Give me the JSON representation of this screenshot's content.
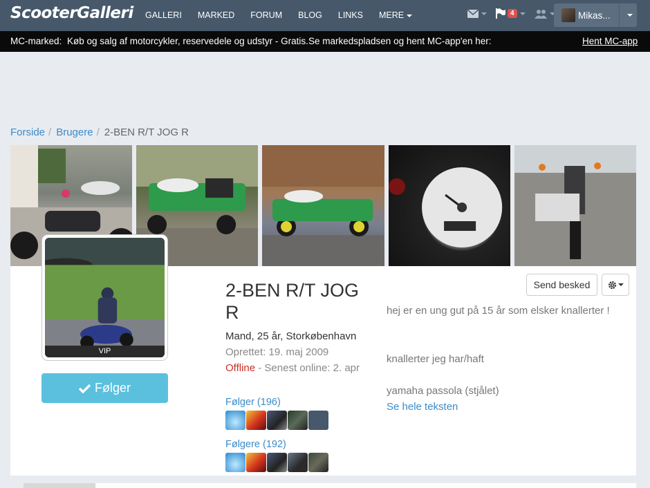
{
  "navbar": {
    "logo": "ScooterGalleri",
    "links": [
      "GALLERI",
      "MARKED",
      "FORUM",
      "BLOG",
      "LINKS",
      "MERE"
    ],
    "icons": [
      "envelope-icon",
      "flag-icon",
      "users-icon"
    ],
    "notification_count": "4",
    "user_name": "Mikas..."
  },
  "ticker": {
    "label": "MC-marked:",
    "text1": "Køb og salg af motorcykler, reservedele og udstyr - Gratis.",
    "text2": "Se markedspladsen og hent MC-app'en her:",
    "link": "Hent MC-app"
  },
  "breadcrumb": {
    "items": [
      "Forside",
      "Brugere"
    ],
    "current": "2-BEN R/T JOG R"
  },
  "profile": {
    "name": "2-BEN R/T JOG R",
    "vip": "VIP",
    "follow_label": "Følger",
    "info": "Mand, 25 år, Storkøbenhavn",
    "created": "Oprettet: 19. maj 2009",
    "status_offline": "Offline",
    "status_rest": " - Senest online: 2. apr",
    "following_label": "Følger (196)",
    "followers_label": "Følgere (192)",
    "send_message": "Send besked"
  },
  "bio": {
    "line1": "hej er en ung gut på 15 år som elsker knallerter !",
    "line2": "knallerter jeg har/haft",
    "line3": "yamaha passola (stjålet)",
    "more_link": "Se hele teksten"
  },
  "colors": {
    "navbar": "#46586a",
    "accent": "#5bc0de",
    "link": "#3b8bc9",
    "offline": "#c9302c"
  }
}
